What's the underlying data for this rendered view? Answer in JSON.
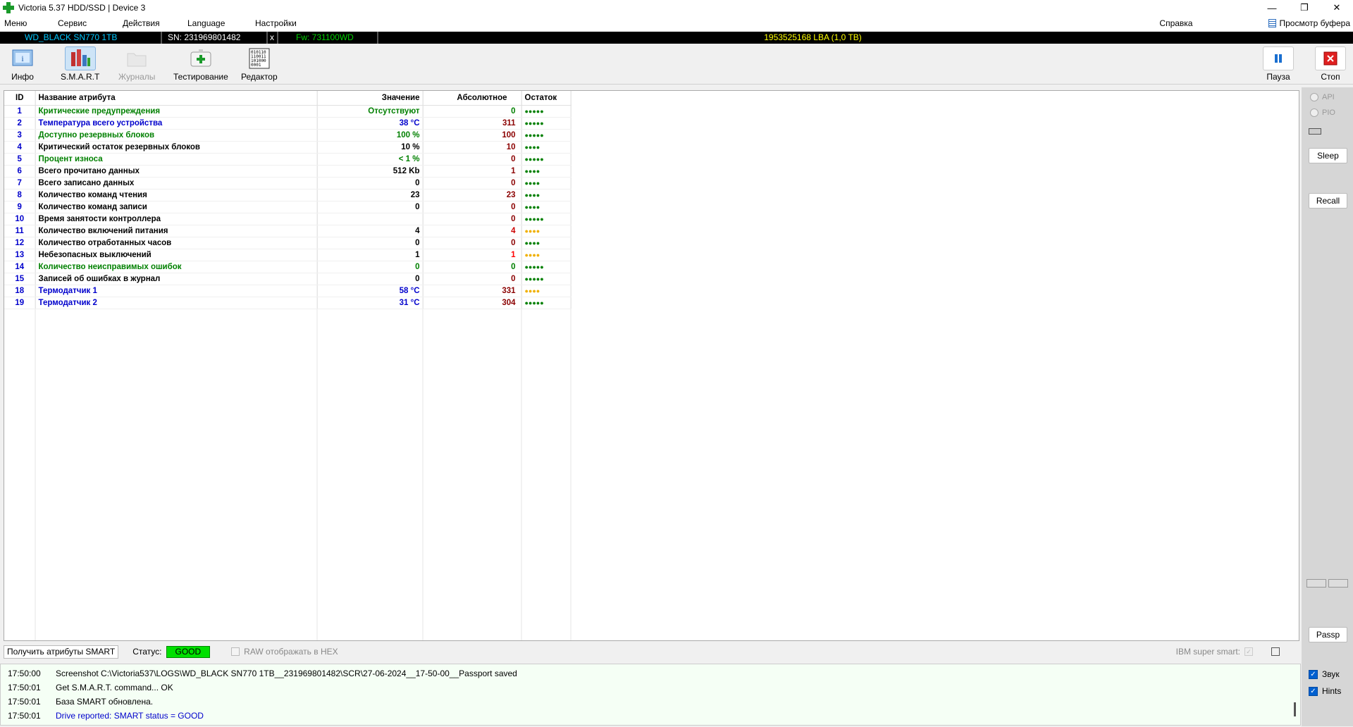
{
  "window": {
    "title": "Victoria 5.37 HDD/SSD | Device 3",
    "minimize": "—",
    "maximize": "❐",
    "close": "✕"
  },
  "menu": {
    "items": [
      "Меню",
      "Сервис",
      "Действия",
      "Language",
      "Настройки"
    ],
    "help": "Справка",
    "buffer_view": "Просмотр буфера"
  },
  "device": {
    "model": "WD_BLACK SN770 1TB",
    "serial": "SN: 231969801482",
    "x": "x",
    "firmware": "Fw: 731100WD",
    "lba": "1953525168 LBA (1,0 TB)"
  },
  "toolbar": {
    "info": "Инфо",
    "smart": "S.M.A.R.T",
    "journals": "Журналы",
    "testing": "Тестирование",
    "editor": "Редактор",
    "editor_icon_text": [
      "010110",
      "110011",
      "101000",
      "0001"
    ],
    "pause": "Пауза",
    "stop": "Стоп"
  },
  "table": {
    "headers": {
      "id": "ID",
      "name": "Название атрибута",
      "value": "Значение",
      "absolute": "Абсолютное",
      "remain": "Остаток"
    },
    "rows": [
      {
        "id": "1",
        "name": "Критические предупреждения",
        "value": "Отсутствуют",
        "abs": "0",
        "dots": "●●●●●",
        "name_color": "#008000",
        "value_color": "#008000",
        "abs_color": "#008000",
        "dots_color": "#008000"
      },
      {
        "id": "2",
        "name": "Температура всего устройства",
        "value": "38 °C",
        "abs": "311",
        "dots": "●●●●●",
        "name_color": "#0000cc",
        "value_color": "#0000cc",
        "abs_color": "#8b0000",
        "dots_color": "#008000"
      },
      {
        "id": "3",
        "name": "Доступно резервных блоков",
        "value": "100 %",
        "abs": "100",
        "dots": "●●●●●",
        "name_color": "#008000",
        "value_color": "#008000",
        "abs_color": "#8b0000",
        "dots_color": "#008000"
      },
      {
        "id": "4",
        "name": "Критический остаток резервных блоков",
        "value": "10 %",
        "abs": "10",
        "dots": "●●●●",
        "name_color": "#000000",
        "value_color": "#000000",
        "abs_color": "#8b0000",
        "dots_color": "#008000"
      },
      {
        "id": "5",
        "name": "Процент износа",
        "value": "< 1 %",
        "abs": "0",
        "dots": "●●●●●",
        "name_color": "#008000",
        "value_color": "#008000",
        "abs_color": "#8b0000",
        "dots_color": "#008000"
      },
      {
        "id": "6",
        "name": "Всего прочитано данных",
        "value": "512 Kb",
        "abs": "1",
        "dots": "●●●●",
        "name_color": "#000000",
        "value_color": "#000000",
        "abs_color": "#8b0000",
        "dots_color": "#008000"
      },
      {
        "id": "7",
        "name": "Всего записано данных",
        "value": "0",
        "abs": "0",
        "dots": "●●●●",
        "name_color": "#000000",
        "value_color": "#000000",
        "abs_color": "#8b0000",
        "dots_color": "#008000"
      },
      {
        "id": "8",
        "name": "Количество команд чтения",
        "value": "23",
        "abs": "23",
        "dots": "●●●●",
        "name_color": "#000000",
        "value_color": "#000000",
        "abs_color": "#8b0000",
        "dots_color": "#008000"
      },
      {
        "id": "9",
        "name": "Количество команд записи",
        "value": "0",
        "abs": "0",
        "dots": "●●●●",
        "name_color": "#000000",
        "value_color": "#000000",
        "abs_color": "#8b0000",
        "dots_color": "#008000"
      },
      {
        "id": "10",
        "name": "Время занятости контроллера",
        "value": "",
        "abs": "0",
        "dots": "●●●●●",
        "name_color": "#000000",
        "value_color": "#000000",
        "abs_color": "#8b0000",
        "dots_color": "#008000"
      },
      {
        "id": "11",
        "name": "Количество включений питания",
        "value": "4",
        "abs": "4",
        "dots": "●●●●",
        "name_color": "#000000",
        "value_color": "#000000",
        "abs_color": "#cc0000",
        "dots_color": "#f0b000"
      },
      {
        "id": "12",
        "name": "Количество отработанных часов",
        "value": "0",
        "abs": "0",
        "dots": "●●●●",
        "name_color": "#000000",
        "value_color": "#000000",
        "abs_color": "#8b0000",
        "dots_color": "#008000"
      },
      {
        "id": "13",
        "name": "Небезопасных выключений",
        "value": "1",
        "abs": "1",
        "dots": "●●●●",
        "name_color": "#000000",
        "value_color": "#000000",
        "abs_color": "#ff0000",
        "dots_color": "#f0b000"
      },
      {
        "id": "14",
        "name": "Количество неисправимых ошибок",
        "value": "0",
        "abs": "0",
        "dots": "●●●●●",
        "name_color": "#008000",
        "value_color": "#008000",
        "abs_color": "#008000",
        "dots_color": "#008000"
      },
      {
        "id": "15",
        "name": "Записей об ошибках в журнал",
        "value": "0",
        "abs": "0",
        "dots": "●●●●●",
        "name_color": "#000000",
        "value_color": "#000000",
        "abs_color": "#8b0000",
        "dots_color": "#008000"
      },
      {
        "id": "18",
        "name": "Термодатчик 1",
        "value": "58 °C",
        "abs": "331",
        "dots": "●●●●",
        "name_color": "#0000cc",
        "value_color": "#0000cc",
        "abs_color": "#8b0000",
        "dots_color": "#f0b000"
      },
      {
        "id": "19",
        "name": "Термодатчик 2",
        "value": "31 °C",
        "abs": "304",
        "dots": "●●●●●",
        "name_color": "#0000cc",
        "value_color": "#0000cc",
        "abs_color": "#8b0000",
        "dots_color": "#008000"
      }
    ]
  },
  "side": {
    "api": "API",
    "pio": "PIO",
    "sleep": "Sleep",
    "recall": "Recall",
    "passp": "Passp",
    "sound": "Звук",
    "hints": "Hints"
  },
  "status": {
    "get_smart": "Получить атрибуты SMART",
    "status_label": "Статус:",
    "status_value": "GOOD",
    "raw_hex": "RAW отображать в HEX",
    "ibm": "IBM super smart:"
  },
  "log": [
    {
      "time": "17:50:00",
      "msg": "Screenshot C:\\Victoria537\\LOGS\\WD_BLACK SN770 1TB__231969801482\\SCR\\27-06-2024__17-50-00__Passport saved",
      "color": "#000000"
    },
    {
      "time": "17:50:01",
      "msg": "Get S.M.A.R.T. command... OK",
      "color": "#000000"
    },
    {
      "time": "17:50:01",
      "msg": "База SMART обновлена.",
      "color": "#000000"
    },
    {
      "time": "17:50:01",
      "msg": "Drive reported: SMART status = GOOD",
      "color": "#0000cc"
    }
  ],
  "colors": {
    "accent_green": "#1a9a2a",
    "good_bg": "#00e000",
    "devbar_cyan": "#00c8ff",
    "devbar_yellow": "#ffff00",
    "devbar_green": "#00d000"
  }
}
